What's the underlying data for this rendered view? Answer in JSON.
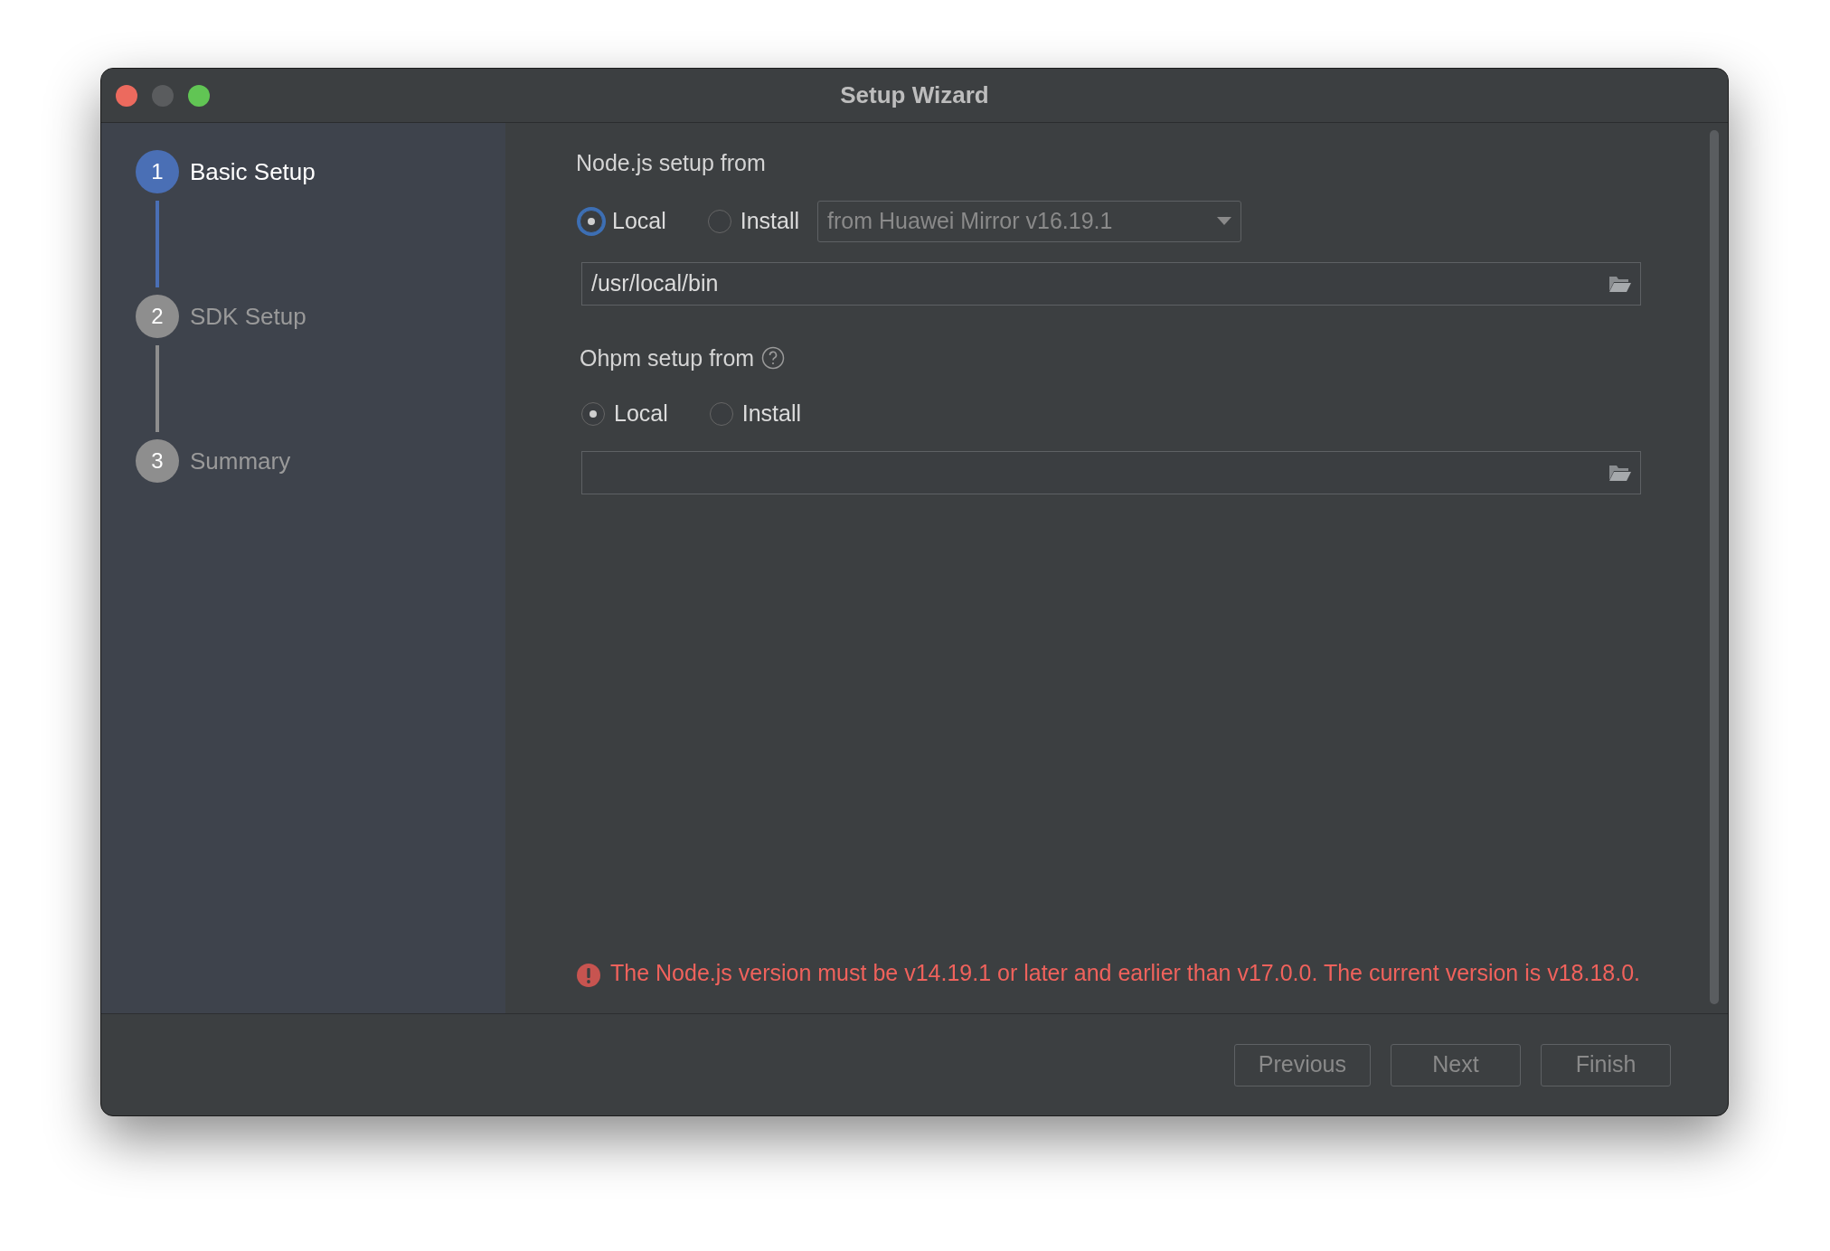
{
  "window": {
    "title": "Setup Wizard"
  },
  "steps": [
    {
      "number": "1",
      "label": "Basic Setup",
      "selected": true
    },
    {
      "number": "2",
      "label": "SDK Setup",
      "selected": false
    },
    {
      "number": "3",
      "label": "Summary",
      "selected": false
    }
  ],
  "nodejs": {
    "label": "Node.js setup from",
    "radios": [
      {
        "label": "Local",
        "selected": true,
        "focused": true
      },
      {
        "label": "Install",
        "selected": false,
        "focused": false
      }
    ],
    "dropdown": {
      "value": "from Huawei Mirror v16.19.1",
      "disabled": true
    },
    "path": {
      "value": "/usr/local/bin"
    }
  },
  "ohpm": {
    "label": "Ohpm setup from",
    "radios": [
      {
        "label": "Local",
        "selected": true,
        "focused": false
      },
      {
        "label": "Install",
        "selected": false,
        "focused": false
      }
    ]
  },
  "error": "The Node.js version must be v14.19.1 or later and earlier than v17.0.0. The current version is v18.18.0.",
  "buttons": [
    {
      "label": "Previous",
      "disabled": true
    },
    {
      "label": "Next",
      "disabled": true
    },
    {
      "label": "Finish",
      "disabled": true
    }
  ]
}
